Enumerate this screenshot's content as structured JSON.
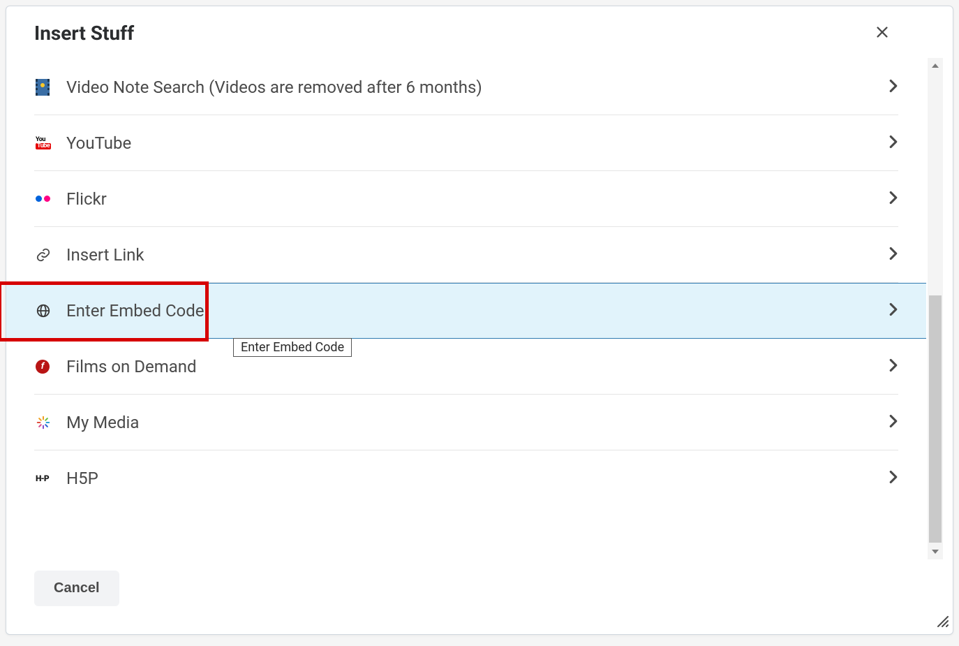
{
  "dialog": {
    "title": "Insert Stuff",
    "cancel_label": "Cancel"
  },
  "tooltip": "Enter Embed Code",
  "youtube_icon": {
    "top": "You",
    "bottom": "Tube"
  },
  "h5p_icon_text": "H-P",
  "films_demand_icon_text": "f",
  "items": [
    {
      "label": "Video Note Search (Videos are removed after 6 months)",
      "icon": "film"
    },
    {
      "label": "YouTube",
      "icon": "youtube"
    },
    {
      "label": "Flickr",
      "icon": "flickr"
    },
    {
      "label": "Insert Link",
      "icon": "link"
    },
    {
      "label": "Enter Embed Code",
      "icon": "globe"
    },
    {
      "label": "Films on Demand",
      "icon": "films-demand"
    },
    {
      "label": "My Media",
      "icon": "burst"
    },
    {
      "label": "H5P",
      "icon": "h5p"
    }
  ],
  "highlighted_index": 4
}
